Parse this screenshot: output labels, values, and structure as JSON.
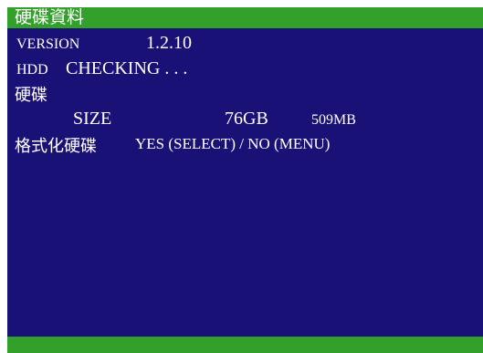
{
  "title": "硬碟資料",
  "version": {
    "label": "VERSION",
    "value": "1.2.10"
  },
  "hdd": {
    "label": "HDD",
    "status": "CHECKING . . ."
  },
  "disk_header": "硬碟",
  "size": {
    "label": "SIZE",
    "value1": "76GB",
    "value2": "509MB"
  },
  "format": {
    "label": "格式化硬碟",
    "prompt": "YES (SELECT) / NO (MENU)"
  },
  "colors": {
    "background": "#1a1177",
    "bar": "#33a02c",
    "text": "#ffffff"
  }
}
